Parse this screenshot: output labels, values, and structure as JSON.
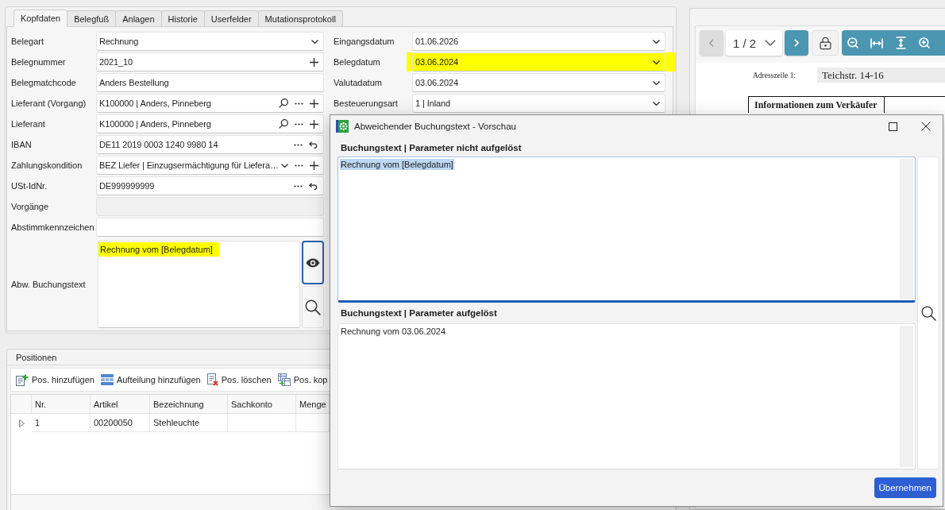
{
  "tabs": [
    {
      "label": "Kopfdaten",
      "selected": true
    },
    {
      "label": "Belegfuß",
      "selected": false
    },
    {
      "label": "Anlagen",
      "selected": false
    },
    {
      "label": "Historie",
      "selected": false
    },
    {
      "label": "Userfelder",
      "selected": false
    },
    {
      "label": "Mutationsprotokoll",
      "selected": false
    }
  ],
  "form": {
    "left": [
      {
        "label": "Belegart",
        "value": "Rechnung",
        "actions": [
          {
            "kind": "dropdown"
          }
        ],
        "disabled": false,
        "highlighted": false
      },
      {
        "label": "Belegnummer",
        "value": "2021_10",
        "actions": [
          {
            "kind": "add"
          }
        ],
        "disabled": false,
        "highlighted": false
      },
      {
        "label": "Belegmatchcode",
        "value": "Anders Bestellung",
        "disabled": false,
        "highlighted": false
      },
      {
        "label": "Lieferant (Vorgang)",
        "value": "K100000 | Anders, Pinneberg",
        "actions": [
          {
            "kind": "search"
          },
          {
            "kind": "more"
          },
          {
            "kind": "add"
          }
        ],
        "disabled": false,
        "highlighted": false
      },
      {
        "label": "Lieferant",
        "value": "K100000 | Anders, Pinneberg",
        "actions": [
          {
            "kind": "search"
          },
          {
            "kind": "more"
          },
          {
            "kind": "add"
          }
        ],
        "disabled": false,
        "highlighted": false
      },
      {
        "label": "IBAN",
        "value": "DE11 2019 0003 1240 9980 14",
        "actions": [
          {
            "kind": "more"
          },
          {
            "kind": "reset"
          }
        ],
        "disabled": false,
        "highlighted": false
      },
      {
        "label": "Zahlungskondition",
        "value": "BEZ Liefer | Einzugsermächtigung für Liefera…",
        "actions": [
          {
            "kind": "dropdown"
          },
          {
            "kind": "more"
          },
          {
            "kind": "add"
          }
        ],
        "disabled": false,
        "highlighted": false
      },
      {
        "label": "USt-IdNr.",
        "value": "DE999999999",
        "actions": [
          {
            "kind": "more"
          },
          {
            "kind": "reset"
          }
        ],
        "disabled": false,
        "highlighted": false
      },
      {
        "label": "Vorgänge",
        "disabled": true,
        "highlighted": false
      },
      {
        "label": "Abstimmkennzeichen",
        "disabled": false,
        "highlighted": false
      }
    ],
    "right": [
      {
        "label": "Eingangsdatum",
        "value": "01.06.2026",
        "actions": [
          {
            "kind": "dropdown"
          }
        ],
        "disabled": false,
        "highlighted": false
      },
      {
        "label": "Belegdatum",
        "value": "03.06.2024",
        "actions": [
          {
            "kind": "dropdown"
          }
        ],
        "disabled": false,
        "highlighted": true
      },
      {
        "label": "Valutadatum",
        "value": "03.06.2024",
        "actions": [
          {
            "kind": "dropdown"
          }
        ],
        "disabled": false,
        "highlighted": false
      },
      {
        "label": "Besteuerungsart",
        "value": "1 | Inland",
        "actions": [
          {
            "kind": "dropdown"
          }
        ],
        "disabled": false,
        "highlighted": false
      }
    ]
  },
  "booking_text": {
    "label": "Abw. Buchungstext",
    "value": "Rechnung vom [Belegdatum]",
    "highlighted": true,
    "buttons": [
      {
        "kind": "preview",
        "focused": true
      },
      {
        "kind": "search",
        "focused": false
      }
    ]
  },
  "positions": {
    "title": "Positionen",
    "toolbar": [
      {
        "kind": "add",
        "label": "Pos. hinzufügen"
      },
      {
        "kind": "split",
        "label": "Aufteilung hinzufügen"
      },
      {
        "kind": "delete",
        "label": "Pos. löschen"
      },
      {
        "kind": "copy",
        "label": "Pos. kop"
      }
    ],
    "columns": [
      "Nr.",
      "Artikel",
      "Bezeichnung",
      "Sachkonto",
      "Menge"
    ],
    "rows": [
      {
        "expanded": false,
        "cells": [
          "1",
          "00200050",
          "Stehleuchte"
        ]
      }
    ]
  },
  "viewer": {
    "prev": {
      "disabled": true
    },
    "page_select": "1 / 2",
    "next": {
      "disabled": false
    },
    "tools": [
      {
        "kind": "zoom_out"
      },
      {
        "kind": "fit_width"
      },
      {
        "kind": "fit_height"
      },
      {
        "kind": "zoom_in"
      }
    ],
    "document": {
      "address_label": "Adresszeile 1:",
      "address_value": "Teichstr. 14-16",
      "table_heading": "Informationen zum Verkäufer"
    }
  },
  "dialog": {
    "title": "Abweichender Buchungstext - Vorschau",
    "sections": [
      {
        "label": "Buchungstext | Parameter nicht aufgelöst",
        "text": "Rechnung vom [Belegdatum]",
        "focused": true,
        "text_selected": true
      },
      {
        "label": "Buchungstext | Parameter aufgelöst",
        "text": "Rechnung vom 03.06.2024",
        "focused": false,
        "text_selected": false
      }
    ],
    "confirm_button": "Übernehmen"
  }
}
